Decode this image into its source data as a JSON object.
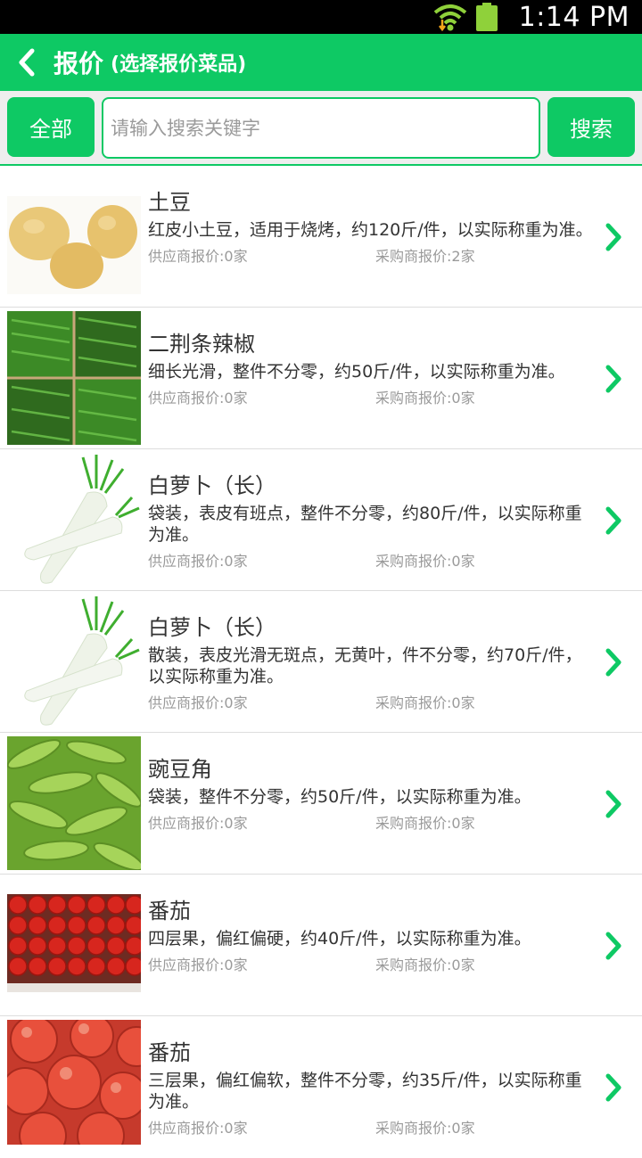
{
  "status": {
    "time": "1:14 PM"
  },
  "header": {
    "title": "报价",
    "subtitle": "(选择报价菜品)"
  },
  "search": {
    "all_label": "全部",
    "placeholder": "请输入搜索关键字",
    "search_label": "搜索"
  },
  "colors": {
    "accent": "#0ec964",
    "muted": "#9a9a9a",
    "text": "#333333"
  },
  "items": [
    {
      "name": "土豆",
      "desc": "红皮小土豆，适用于烧烤，约120斤/件，以实际称重为准。",
      "supplier": "供应商报价:0家",
      "buyer": "采购商报价:2家",
      "icon": "potato"
    },
    {
      "name": "二荆条辣椒",
      "desc": "细长光滑，整件不分零，约50斤/件，以实际称重为准。",
      "supplier": "供应商报价:0家",
      "buyer": "采购商报价:0家",
      "icon": "green-chili"
    },
    {
      "name": "白萝卜（长）",
      "desc": "袋装，表皮有班点，整件不分零，约80斤/件，以实际称重为准。",
      "supplier": "供应商报价:0家",
      "buyer": "采购商报价:0家",
      "icon": "white-radish"
    },
    {
      "name": "白萝卜（长）",
      "desc": "散装，表皮光滑无斑点，无黄叶，件不分零，约70斤/件，以实际称重为准。",
      "supplier": "供应商报价:0家",
      "buyer": "采购商报价:0家",
      "icon": "white-radish"
    },
    {
      "name": "豌豆角",
      "desc": "袋装，整件不分零，约50斤/件，以实际称重为准。",
      "supplier": "供应商报价:0家",
      "buyer": "采购商报价:0家",
      "icon": "snow-pea"
    },
    {
      "name": "番茄",
      "desc": "四层果，偏红偏硬，约40斤/件，以实际称重为准。",
      "supplier": "供应商报价:0家",
      "buyer": "采购商报价:0家",
      "icon": "tomato-crate"
    },
    {
      "name": "番茄",
      "desc": "三层果，偏红偏软，整件不分零，约35斤/件，以实际称重为准。",
      "supplier": "供应商报价:0家",
      "buyer": "采购商报价:0家",
      "icon": "tomatoes"
    }
  ]
}
